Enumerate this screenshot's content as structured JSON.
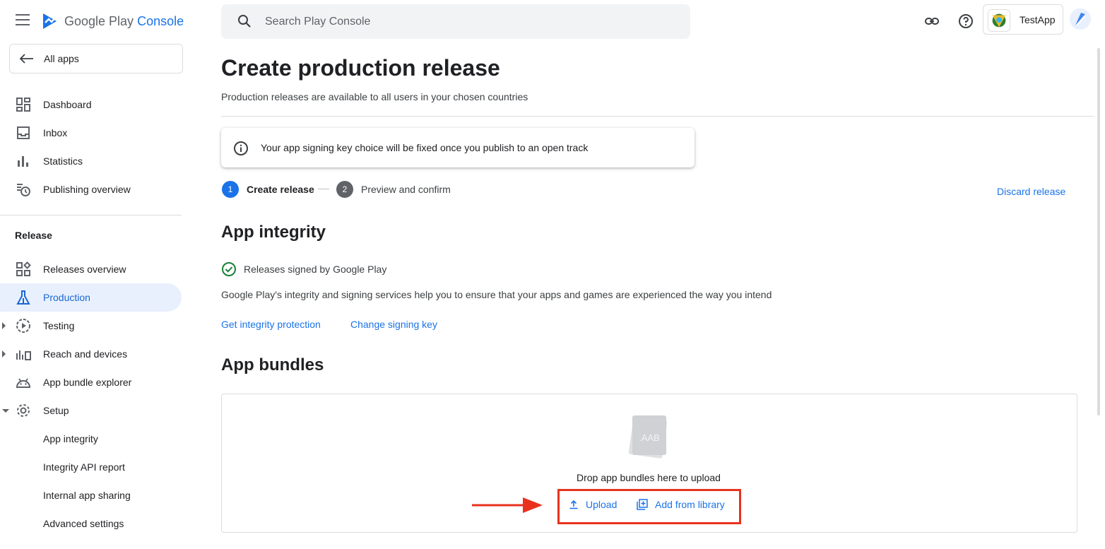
{
  "brand": {
    "name": "Google Play",
    "suffix": "Console"
  },
  "sidebar": {
    "all_apps": "All apps",
    "items": [
      {
        "label": "Dashboard"
      },
      {
        "label": "Inbox"
      },
      {
        "label": "Statistics"
      },
      {
        "label": "Publishing overview"
      }
    ],
    "section": "Release",
    "release_items": [
      {
        "label": "Releases overview"
      },
      {
        "label": "Production"
      },
      {
        "label": "Testing"
      },
      {
        "label": "Reach and devices"
      },
      {
        "label": "App bundle explorer"
      },
      {
        "label": "Setup"
      },
      {
        "label": "App integrity"
      },
      {
        "label": "Integrity API report"
      },
      {
        "label": "Internal app sharing"
      },
      {
        "label": "Advanced settings"
      }
    ]
  },
  "header": {
    "search_placeholder": "Search Play Console",
    "app_name": "TestApp"
  },
  "main": {
    "title": "Create production release",
    "subtitle": "Production releases are available to all users in your chosen countries",
    "info": "Your app signing key choice will be fixed once you publish to an open track",
    "steps": [
      {
        "num": "1",
        "label": "Create release"
      },
      {
        "num": "2",
        "label": "Preview and confirm"
      }
    ],
    "discard": "Discard release",
    "integrity": {
      "heading": "App integrity",
      "signed": "Releases signed by Google Play",
      "description": "Google Play's integrity and signing services help you to ensure that your apps and games are experienced the way you intend",
      "link_protection": "Get integrity protection",
      "link_change_key": "Change signing key"
    },
    "bundles": {
      "heading": "App bundles",
      "file_label": ".AAB",
      "drop_text": "Drop app bundles here to upload",
      "upload": "Upload",
      "add_library": "Add from library"
    }
  },
  "colors": {
    "accent": "#1a73e8",
    "active_bg": "#e8f0fe",
    "highlight": "#e8321e",
    "success": "#188038"
  }
}
